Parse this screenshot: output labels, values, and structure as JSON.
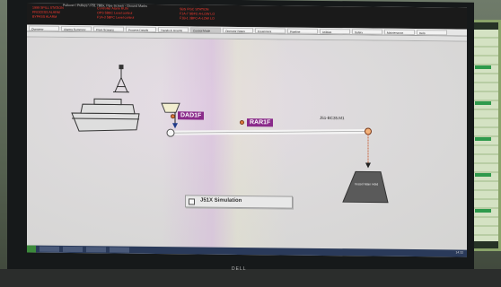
{
  "window": {
    "title": "Pullover \\ Pulleys \\ F51 7BBx, Pipe Screen - Ground Marks",
    "alarms_col1": [
      "1999 SPILL STATION",
      "PROCESS ALARM",
      "BYPASS ALARM"
    ],
    "alarms_col2": [
      "Controller Alarm RUN",
      "OPS 5BEC Level control",
      "F1A-3 5BFC Level control"
    ],
    "alarms_col3": [
      "SBS FISC STATION",
      "F1A-7 SBFC-A-LOW LO",
      "F1B-1 3BFC-A-LOW LO"
    ]
  },
  "menu": {
    "tabs": [
      "Overview",
      "Alarms Summary",
      "Plant Screens",
      "Process Details",
      "Trends & Graphs",
      "Control Mode",
      "Operator Notes",
      "Equipment",
      "Pipeline",
      "Utilities",
      "Safety",
      "Maintenance",
      "Help"
    ]
  },
  "diagram": {
    "tag_dad1f": "DAD1F",
    "tag_rar1f": "RAR1F",
    "line_label": "J51-BC35.M1",
    "vessel_label": "Vessel Main Hold",
    "simulation_label": "J51X Simulation"
  },
  "taskbar": {
    "clock": "14:32"
  },
  "monitor": {
    "brand": "DELL"
  },
  "colors": {
    "tag_bg": "#8a2a8a",
    "alarm_text": "#ff3b30",
    "marker": "#e07a3c",
    "line": "#f4f4f4"
  }
}
